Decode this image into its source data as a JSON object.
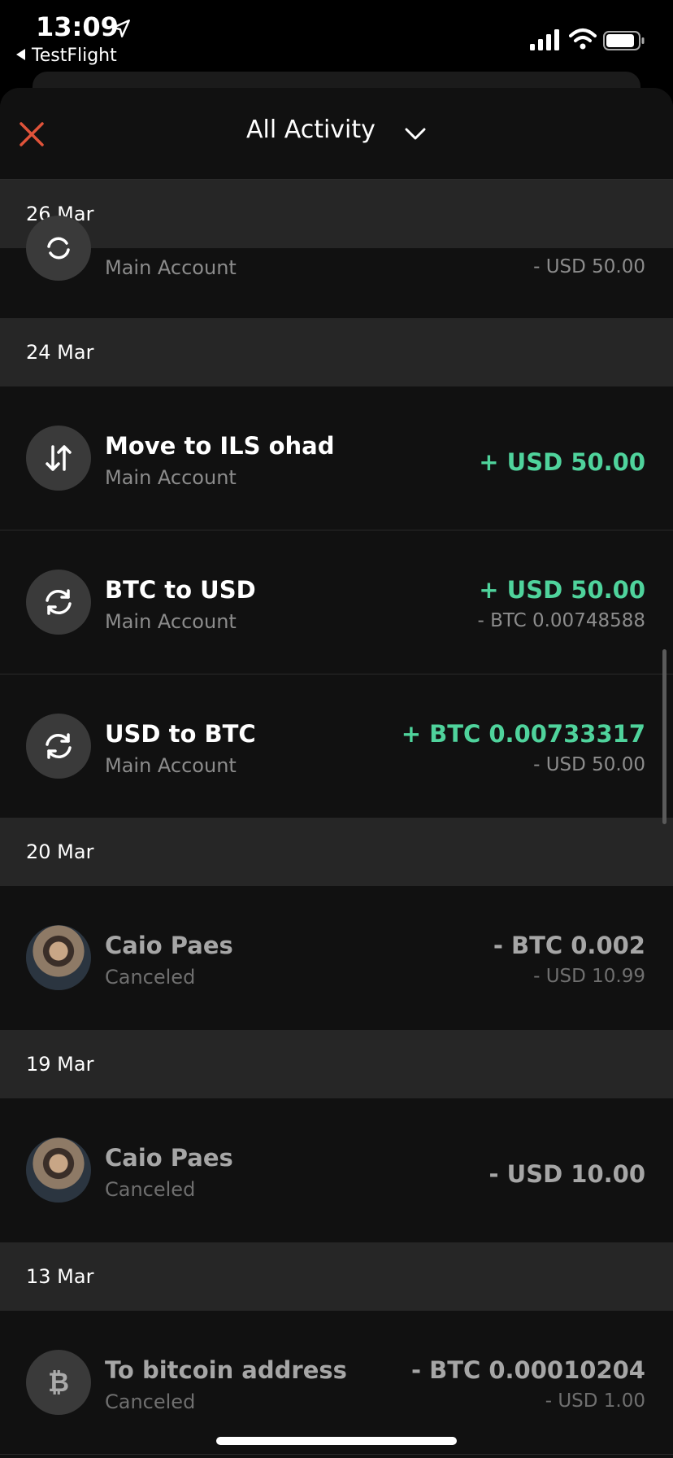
{
  "status": {
    "time": "13:09",
    "back_label": "TestFlight"
  },
  "header": {
    "title": "All Activity"
  },
  "colors": {
    "positive": "#4fd39c",
    "close": "#e0533a"
  },
  "sections": [
    {
      "date": "26 Mar",
      "items": [
        {
          "icon": "exchange-icon",
          "name": "",
          "sub": "Main Account",
          "amount": "",
          "amount2": "- USD 50.00"
        }
      ]
    },
    {
      "date": "24 Mar",
      "items": [
        {
          "icon": "transfer-arrows-icon",
          "name": "Move to ILS ohad",
          "sub": "Main Account",
          "amount": "+ USD 50.00",
          "amount2": ""
        },
        {
          "icon": "exchange-icon",
          "name": "BTC to USD",
          "sub": "Main Account",
          "amount": "+ USD 50.00",
          "amount2": "- BTC 0.00748588"
        },
        {
          "icon": "exchange-icon",
          "name": "USD to BTC",
          "sub": "Main Account",
          "amount": "+ BTC 0.00733317",
          "amount2": "- USD 50.00"
        }
      ]
    },
    {
      "date": "20 Mar",
      "items": [
        {
          "icon": "avatar-photo",
          "name": "Caio Paes",
          "sub": "Canceled",
          "amount": "- BTC 0.002",
          "amount2": "- USD 10.99"
        }
      ]
    },
    {
      "date": "19 Mar",
      "items": [
        {
          "icon": "avatar-photo",
          "name": "Caio Paes",
          "sub": "Canceled",
          "amount": "- USD 10.00",
          "amount2": ""
        }
      ]
    },
    {
      "date": "13 Mar",
      "items": [
        {
          "icon": "bitcoin-icon",
          "name": "To bitcoin address",
          "sub": "Canceled",
          "amount": "- BTC 0.00010204",
          "amount2": "- USD 1.00"
        }
      ]
    }
  ]
}
